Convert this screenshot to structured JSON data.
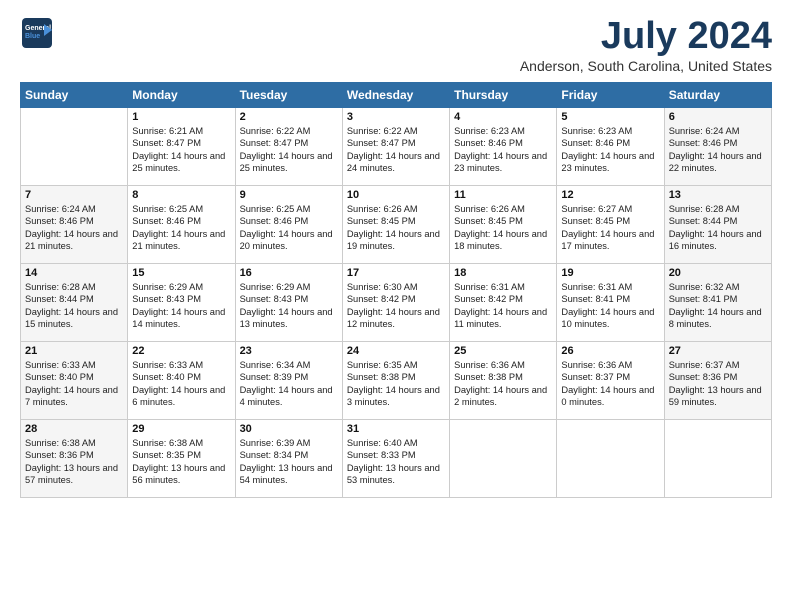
{
  "logo": {
    "line1": "General",
    "line2": "Blue"
  },
  "title": "July 2024",
  "location": "Anderson, South Carolina, United States",
  "days_of_week": [
    "Sunday",
    "Monday",
    "Tuesday",
    "Wednesday",
    "Thursday",
    "Friday",
    "Saturday"
  ],
  "weeks": [
    [
      {
        "day": "",
        "sunrise": "",
        "sunset": "",
        "daylight": ""
      },
      {
        "day": "1",
        "sunrise": "6:21 AM",
        "sunset": "8:47 PM",
        "daylight": "14 hours and 25 minutes."
      },
      {
        "day": "2",
        "sunrise": "6:22 AM",
        "sunset": "8:47 PM",
        "daylight": "14 hours and 25 minutes."
      },
      {
        "day": "3",
        "sunrise": "6:22 AM",
        "sunset": "8:47 PM",
        "daylight": "14 hours and 24 minutes."
      },
      {
        "day": "4",
        "sunrise": "6:23 AM",
        "sunset": "8:46 PM",
        "daylight": "14 hours and 23 minutes."
      },
      {
        "day": "5",
        "sunrise": "6:23 AM",
        "sunset": "8:46 PM",
        "daylight": "14 hours and 23 minutes."
      },
      {
        "day": "6",
        "sunrise": "6:24 AM",
        "sunset": "8:46 PM",
        "daylight": "14 hours and 22 minutes."
      }
    ],
    [
      {
        "day": "7",
        "sunrise": "6:24 AM",
        "sunset": "8:46 PM",
        "daylight": "14 hours and 21 minutes."
      },
      {
        "day": "8",
        "sunrise": "6:25 AM",
        "sunset": "8:46 PM",
        "daylight": "14 hours and 21 minutes."
      },
      {
        "day": "9",
        "sunrise": "6:25 AM",
        "sunset": "8:46 PM",
        "daylight": "14 hours and 20 minutes."
      },
      {
        "day": "10",
        "sunrise": "6:26 AM",
        "sunset": "8:45 PM",
        "daylight": "14 hours and 19 minutes."
      },
      {
        "day": "11",
        "sunrise": "6:26 AM",
        "sunset": "8:45 PM",
        "daylight": "14 hours and 18 minutes."
      },
      {
        "day": "12",
        "sunrise": "6:27 AM",
        "sunset": "8:45 PM",
        "daylight": "14 hours and 17 minutes."
      },
      {
        "day": "13",
        "sunrise": "6:28 AM",
        "sunset": "8:44 PM",
        "daylight": "14 hours and 16 minutes."
      }
    ],
    [
      {
        "day": "14",
        "sunrise": "6:28 AM",
        "sunset": "8:44 PM",
        "daylight": "14 hours and 15 minutes."
      },
      {
        "day": "15",
        "sunrise": "6:29 AM",
        "sunset": "8:43 PM",
        "daylight": "14 hours and 14 minutes."
      },
      {
        "day": "16",
        "sunrise": "6:29 AM",
        "sunset": "8:43 PM",
        "daylight": "14 hours and 13 minutes."
      },
      {
        "day": "17",
        "sunrise": "6:30 AM",
        "sunset": "8:42 PM",
        "daylight": "14 hours and 12 minutes."
      },
      {
        "day": "18",
        "sunrise": "6:31 AM",
        "sunset": "8:42 PM",
        "daylight": "14 hours and 11 minutes."
      },
      {
        "day": "19",
        "sunrise": "6:31 AM",
        "sunset": "8:41 PM",
        "daylight": "14 hours and 10 minutes."
      },
      {
        "day": "20",
        "sunrise": "6:32 AM",
        "sunset": "8:41 PM",
        "daylight": "14 hours and 8 minutes."
      }
    ],
    [
      {
        "day": "21",
        "sunrise": "6:33 AM",
        "sunset": "8:40 PM",
        "daylight": "14 hours and 7 minutes."
      },
      {
        "day": "22",
        "sunrise": "6:33 AM",
        "sunset": "8:40 PM",
        "daylight": "14 hours and 6 minutes."
      },
      {
        "day": "23",
        "sunrise": "6:34 AM",
        "sunset": "8:39 PM",
        "daylight": "14 hours and 4 minutes."
      },
      {
        "day": "24",
        "sunrise": "6:35 AM",
        "sunset": "8:38 PM",
        "daylight": "14 hours and 3 minutes."
      },
      {
        "day": "25",
        "sunrise": "6:36 AM",
        "sunset": "8:38 PM",
        "daylight": "14 hours and 2 minutes."
      },
      {
        "day": "26",
        "sunrise": "6:36 AM",
        "sunset": "8:37 PM",
        "daylight": "14 hours and 0 minutes."
      },
      {
        "day": "27",
        "sunrise": "6:37 AM",
        "sunset": "8:36 PM",
        "daylight": "13 hours and 59 minutes."
      }
    ],
    [
      {
        "day": "28",
        "sunrise": "6:38 AM",
        "sunset": "8:36 PM",
        "daylight": "13 hours and 57 minutes."
      },
      {
        "day": "29",
        "sunrise": "6:38 AM",
        "sunset": "8:35 PM",
        "daylight": "13 hours and 56 minutes."
      },
      {
        "day": "30",
        "sunrise": "6:39 AM",
        "sunset": "8:34 PM",
        "daylight": "13 hours and 54 minutes."
      },
      {
        "day": "31",
        "sunrise": "6:40 AM",
        "sunset": "8:33 PM",
        "daylight": "13 hours and 53 minutes."
      },
      {
        "day": "",
        "sunrise": "",
        "sunset": "",
        "daylight": ""
      },
      {
        "day": "",
        "sunrise": "",
        "sunset": "",
        "daylight": ""
      },
      {
        "day": "",
        "sunrise": "",
        "sunset": "",
        "daylight": ""
      }
    ]
  ]
}
